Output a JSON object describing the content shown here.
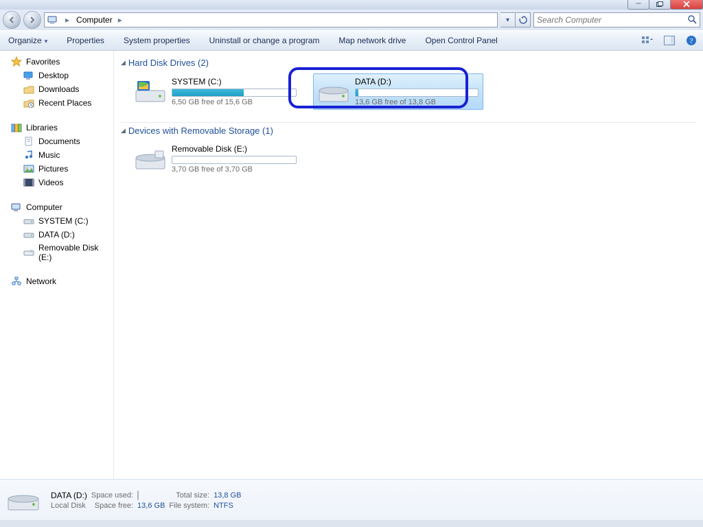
{
  "breadcrumb": {
    "root_label": "Computer"
  },
  "search": {
    "placeholder": "Search Computer"
  },
  "toolbar": {
    "organize": "Organize",
    "properties": "Properties",
    "system_properties": "System properties",
    "uninstall": "Uninstall or change a program",
    "map_drive": "Map network drive",
    "control_panel": "Open Control Panel"
  },
  "sidebar": {
    "favorites": {
      "header": "Favorites",
      "desktop": "Desktop",
      "downloads": "Downloads",
      "recent": "Recent Places"
    },
    "libraries": {
      "header": "Libraries",
      "documents": "Documents",
      "music": "Music",
      "pictures": "Pictures",
      "videos": "Videos"
    },
    "computer": {
      "header": "Computer",
      "c": "SYSTEM (C:)",
      "d": "DATA (D:)",
      "e": "Removable Disk (E:)"
    },
    "network": {
      "header": "Network"
    }
  },
  "groups": {
    "hdd": {
      "title": "Hard Disk Drives (2)"
    },
    "removable": {
      "title": "Devices with Removable Storage (1)"
    }
  },
  "drives": {
    "c": {
      "name": "SYSTEM (C:)",
      "free": "6,50 GB free of 15,6 GB",
      "fill_pct": 58
    },
    "d": {
      "name": "DATA (D:)",
      "free": "13,6 GB free of 13,8 GB",
      "fill_pct": 2
    },
    "e": {
      "name": "Removable Disk (E:)",
      "free": "3,70 GB free of 3,70 GB",
      "fill_pct": 0
    }
  },
  "details": {
    "name": "DATA (D:)",
    "type": "Local Disk",
    "space_used_label": "Space used:",
    "space_free_label": "Space free:",
    "space_free_value": "13,6 GB",
    "total_size_label": "Total size:",
    "total_size_value": "13,8 GB",
    "fs_label": "File system:",
    "fs_value": "NTFS",
    "used_fill_pct": 2
  }
}
